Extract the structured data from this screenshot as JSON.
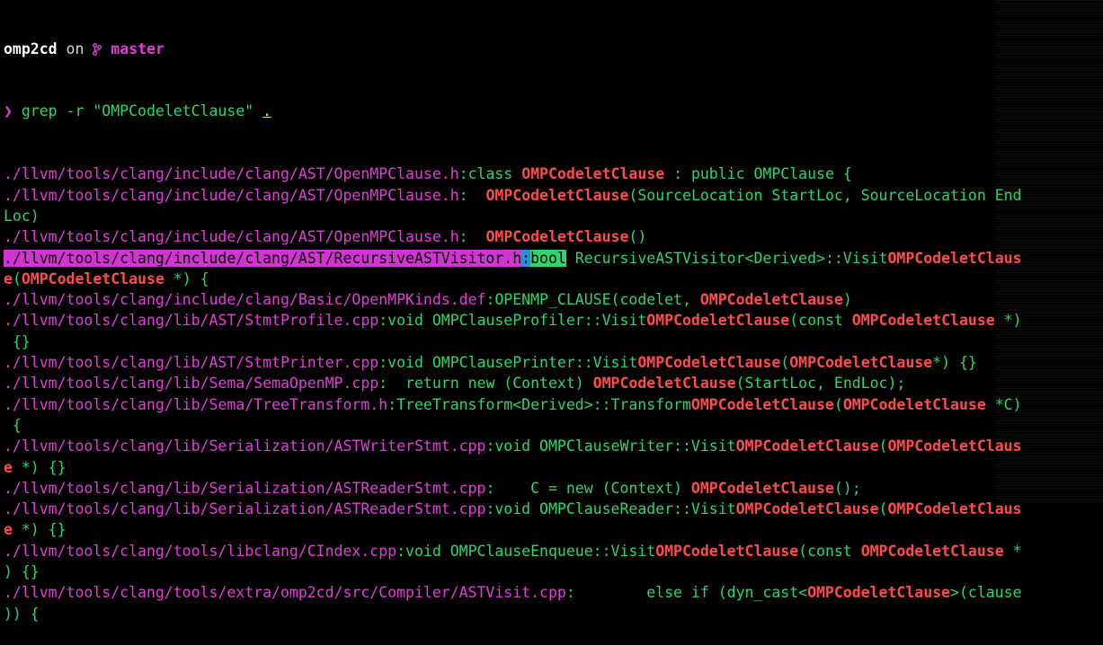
{
  "prompt": {
    "dir": "omp2cd",
    "on": " on ",
    "branch_icon": "branch-icon",
    "branch": "master",
    "symbol": "❯",
    "command": " grep -r \"OMPCodeletClause\" ",
    "command_arg": "."
  },
  "lines": [
    [
      {
        "c": "m",
        "t": "./llvm/tools/clang/include/clang/AST/OpenMPClause.h"
      },
      {
        "c": "g",
        "t": ":class "
      },
      {
        "c": "b",
        "t": "OMPCodeletClause"
      },
      {
        "c": "g",
        "t": " : public OMPClause {"
      }
    ],
    [
      {
        "c": "m",
        "t": "./llvm/tools/clang/include/clang/AST/OpenMPClause.h"
      },
      {
        "c": "g",
        "t": ":  "
      },
      {
        "c": "b",
        "t": "OMPCodeletClause"
      },
      {
        "c": "g",
        "t": "(SourceLocation StartLoc, SourceLocation End"
      }
    ],
    [
      {
        "c": "g",
        "t": "Loc)"
      }
    ],
    [
      {
        "c": "m",
        "t": "./llvm/tools/clang/include/clang/AST/OpenMPClause.h"
      },
      {
        "c": "g",
        "t": ":  "
      },
      {
        "c": "b",
        "t": "OMPCodeletClause"
      },
      {
        "c": "g",
        "t": "()"
      }
    ],
    [
      {
        "c": "sel-m",
        "t": "./llvm/tools/clang/include/clang/AST/RecursiveASTVisitor.h"
      },
      {
        "c": "sel-b",
        "t": ":"
      },
      {
        "c": "sel-g",
        "t": "bool"
      },
      {
        "c": "g",
        "t": " RecursiveASTVisitor<Derived>::Visit"
      },
      {
        "c": "b",
        "t": "OMPCodeletClaus"
      }
    ],
    [
      {
        "c": "b",
        "t": "e"
      },
      {
        "c": "g",
        "t": "("
      },
      {
        "c": "b",
        "t": "OMPCodeletClause"
      },
      {
        "c": "g",
        "t": " *) {"
      }
    ],
    [
      {
        "c": "m",
        "t": "./llvm/tools/clang/include/clang/Basic/OpenMPKinds.def"
      },
      {
        "c": "g",
        "t": ":OPENMP_CLAUSE(codelet, "
      },
      {
        "c": "b",
        "t": "OMPCodeletClause"
      },
      {
        "c": "g",
        "t": ")"
      }
    ],
    [
      {
        "c": "m",
        "t": "./llvm/tools/clang/lib/AST/StmtProfile.cpp"
      },
      {
        "c": "g",
        "t": ":void OMPClauseProfiler::Visit"
      },
      {
        "c": "b",
        "t": "OMPCodeletClause"
      },
      {
        "c": "g",
        "t": "(const "
      },
      {
        "c": "b",
        "t": "OMPCodeletClause"
      },
      {
        "c": "g",
        "t": " *)"
      }
    ],
    [
      {
        "c": "g",
        "t": " {}"
      }
    ],
    [
      {
        "c": "m",
        "t": "./llvm/tools/clang/lib/AST/StmtPrinter.cpp"
      },
      {
        "c": "g",
        "t": ":void OMPClausePrinter::Visit"
      },
      {
        "c": "b",
        "t": "OMPCodeletClause"
      },
      {
        "c": "g",
        "t": "("
      },
      {
        "c": "b",
        "t": "OMPCodeletClause"
      },
      {
        "c": "g",
        "t": "*) {}"
      }
    ],
    [
      {
        "c": "m",
        "t": "./llvm/tools/clang/lib/Sema/SemaOpenMP.cpp"
      },
      {
        "c": "g",
        "t": ":  return new (Context) "
      },
      {
        "c": "b",
        "t": "OMPCodeletClause"
      },
      {
        "c": "g",
        "t": "(StartLoc, EndLoc);"
      }
    ],
    [
      {
        "c": "m",
        "t": "./llvm/tools/clang/lib/Sema/TreeTransform.h"
      },
      {
        "c": "g",
        "t": ":TreeTransform<Derived>::Transform"
      },
      {
        "c": "b",
        "t": "OMPCodeletClause"
      },
      {
        "c": "g",
        "t": "("
      },
      {
        "c": "b",
        "t": "OMPCodeletClause"
      },
      {
        "c": "g",
        "t": " *C)"
      }
    ],
    [
      {
        "c": "g",
        "t": " {"
      }
    ],
    [
      {
        "c": "m",
        "t": "./llvm/tools/clang/lib/Serialization/ASTWriterStmt.cpp"
      },
      {
        "c": "g",
        "t": ":void OMPClauseWriter::Visit"
      },
      {
        "c": "b",
        "t": "OMPCodeletClause"
      },
      {
        "c": "g",
        "t": "("
      },
      {
        "c": "b",
        "t": "OMPCodeletClaus"
      }
    ],
    [
      {
        "c": "b",
        "t": "e"
      },
      {
        "c": "g",
        "t": " *) {}"
      }
    ],
    [
      {
        "c": "m",
        "t": "./llvm/tools/clang/lib/Serialization/ASTReaderStmt.cpp"
      },
      {
        "c": "g",
        "t": ":    C = new (Context) "
      },
      {
        "c": "b",
        "t": "OMPCodeletClause"
      },
      {
        "c": "g",
        "t": "();"
      }
    ],
    [
      {
        "c": "m",
        "t": "./llvm/tools/clang/lib/Serialization/ASTReaderStmt.cpp"
      },
      {
        "c": "g",
        "t": ":void OMPClauseReader::Visit"
      },
      {
        "c": "b",
        "t": "OMPCodeletClause"
      },
      {
        "c": "g",
        "t": "("
      },
      {
        "c": "b",
        "t": "OMPCodeletClaus"
      }
    ],
    [
      {
        "c": "b",
        "t": "e"
      },
      {
        "c": "g",
        "t": " *) {}"
      }
    ],
    [
      {
        "c": "m",
        "t": "./llvm/tools/clang/tools/libclang/CIndex.cpp"
      },
      {
        "c": "g",
        "t": ":void OMPClauseEnqueue::Visit"
      },
      {
        "c": "b",
        "t": "OMPCodeletClause"
      },
      {
        "c": "g",
        "t": "(const "
      },
      {
        "c": "b",
        "t": "OMPCodeletClause"
      },
      {
        "c": "g",
        "t": " *"
      }
    ],
    [
      {
        "c": "g",
        "t": ") {}"
      }
    ],
    [
      {
        "c": "m",
        "t": "./llvm/tools/clang/tools/extra/omp2cd/src/Compiler/ASTVisit.cpp"
      },
      {
        "c": "g",
        "t": ":        else if (dyn_cast<"
      },
      {
        "c": "b",
        "t": "OMPCodeletClause"
      },
      {
        "c": "g",
        "t": ">(clause"
      }
    ],
    [
      {
        "c": "g",
        "t": ")) {"
      }
    ]
  ],
  "colors": {
    "background": "#000000",
    "path": "#e23ed6",
    "text": "#2bd66a",
    "match": "#ff4b4b",
    "selection_path": "#d233d2",
    "selection_colon": "#2a8fd6",
    "selection_word": "#2bd66a"
  }
}
